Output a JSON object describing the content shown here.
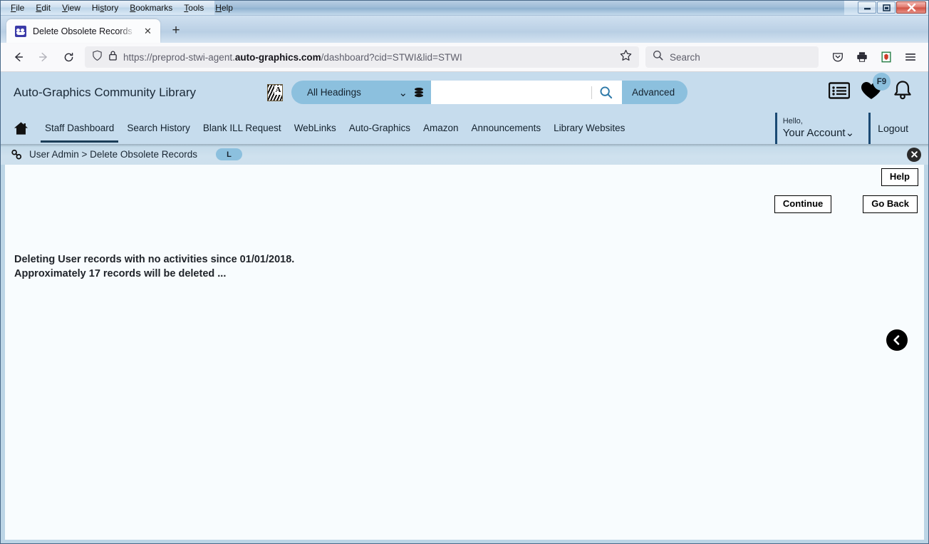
{
  "browser": {
    "menus": [
      "File",
      "Edit",
      "View",
      "History",
      "Bookmarks",
      "Tools",
      "Help"
    ],
    "window_controls": {
      "minimize": "–",
      "maximize": "❐",
      "close": "✕"
    },
    "tab": {
      "title": "Delete Obsolete Records | STWI",
      "close_label": "✕",
      "newtab_label": "+"
    },
    "toolbar": {
      "back_label": "←",
      "forward_label": "→",
      "reload_label": "⟳",
      "url_prefix": "https://preprod-stwi-agent.",
      "url_domain": "auto-graphics.com",
      "url_suffix": "/dashboard?cid=STWI&lid=STWI",
      "bookmark_label": "☆",
      "search_placeholder": "Search",
      "icons": [
        "shield-icon",
        "lock-icon",
        "pocket-icon",
        "print-icon",
        "extension-icon",
        "menu-icon"
      ]
    }
  },
  "app": {
    "library_name": "Auto-Graphics Community Library",
    "search": {
      "scope_selected": "All Headings",
      "scope_caret": "⌄",
      "query_value": "",
      "query_placeholder": "",
      "advanced_label": "Advanced"
    },
    "header_icons": [
      {
        "name": "list-icon"
      },
      {
        "name": "heart-icon",
        "badge": "F9"
      },
      {
        "name": "bell-icon"
      }
    ],
    "nav": {
      "home_icon": "home-icon",
      "items": [
        {
          "label": "Staff Dashboard",
          "active": true
        },
        {
          "label": "Search History",
          "active": false
        },
        {
          "label": "Blank ILL Request",
          "active": false
        },
        {
          "label": "WebLinks",
          "active": false
        },
        {
          "label": "Auto-Graphics",
          "active": false
        },
        {
          "label": "Amazon",
          "active": false
        },
        {
          "label": "Announcements",
          "active": false
        },
        {
          "label": "Library Websites",
          "active": false
        }
      ]
    },
    "account": {
      "hello": "Hello,",
      "name": "Your Account",
      "caret": "⌄",
      "logout": "Logout"
    },
    "breadcrumb": {
      "icon": "chain-link-icon",
      "path": "User Admin > Delete Obsolete Records",
      "badge": "L",
      "close_label": "✕"
    },
    "content": {
      "help_label": "Help",
      "continue_label": "Continue",
      "go_back_label": "Go Back",
      "message_line1": "Deleting User records with no activities since 01/01/2018.",
      "message_line2": "Approximately 17 records will be deleted ...",
      "back_arrow": "‹"
    }
  },
  "colors": {
    "header_bg": "#c6dced",
    "accent": "#8cc0de",
    "content_border": "#bcd5e6",
    "nav_active": "#1b3d57"
  }
}
